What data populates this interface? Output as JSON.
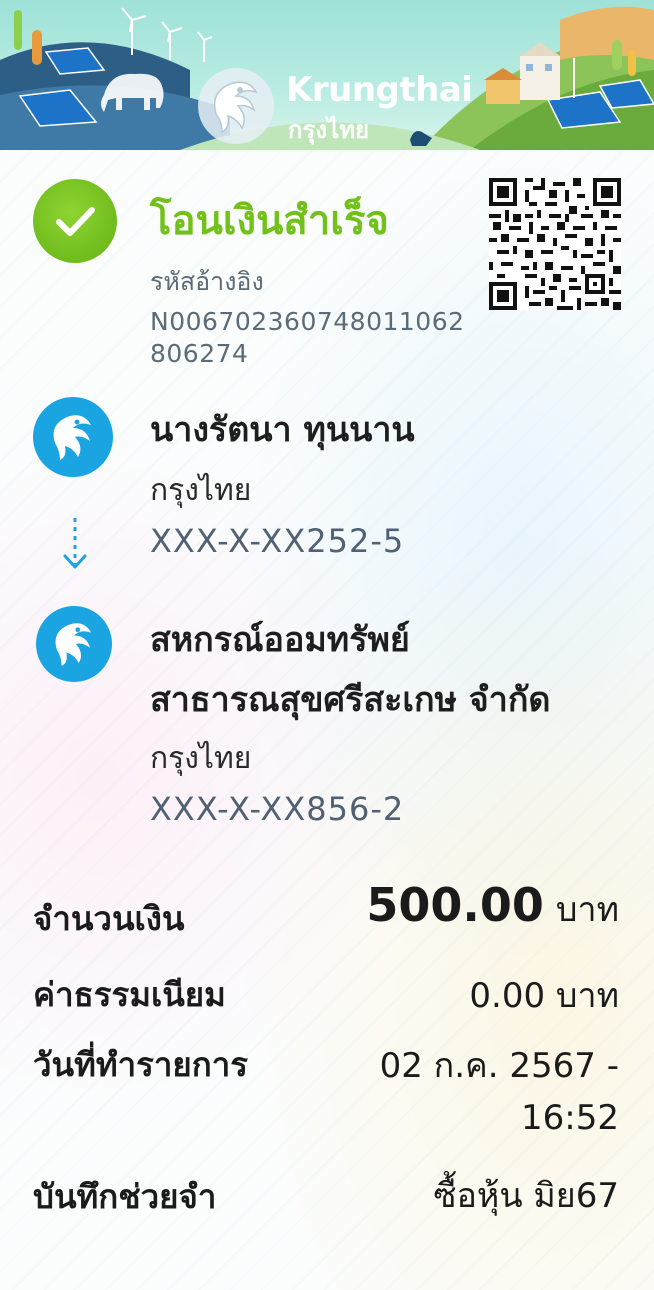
{
  "bank": {
    "name_en": "Krungthai",
    "name_th": "กรุงไทย"
  },
  "status": {
    "title": "โอนเงินสำเร็จ",
    "ref_label": "รหัสอ้างอิง",
    "ref_number": "N006702360748011062806274"
  },
  "from": {
    "name": "นางรัตนา ทุนนาน",
    "bank": "กรุงไทย",
    "account": "XXX-X-XX252-5"
  },
  "to": {
    "name_line1": "สหกรณ์ออมทรัพย์",
    "name_line2": "สาธารณสุขศรีสะเกษ จำกัด",
    "bank": "กรุงไทย",
    "account": "XXX-X-XX856-2"
  },
  "details": {
    "amount_label": "จำนวนเงิน",
    "amount_value": "500.00",
    "amount_unit": "บาท",
    "fee_label": "ค่าธรรมเนียม",
    "fee_value": "0.00 บาท",
    "date_label": "วันที่ทำรายการ",
    "date_line1": "02 ก.ค. 2567 -",
    "date_line2": "16:52",
    "memo_label": "บันทึกช่วยจำ",
    "memo_value": "ซื้อหุ้น มิย67"
  },
  "icons": {
    "status": "check-icon",
    "qr": "qr-code-icon",
    "from_bank": "krungthai-logo-icon",
    "to_bank": "krungthai-logo-icon",
    "direction": "arrow-down-icon"
  },
  "colors": {
    "success": "#72c11b",
    "bank_blue": "#1ba4e2",
    "account_gray": "#4f6173"
  }
}
